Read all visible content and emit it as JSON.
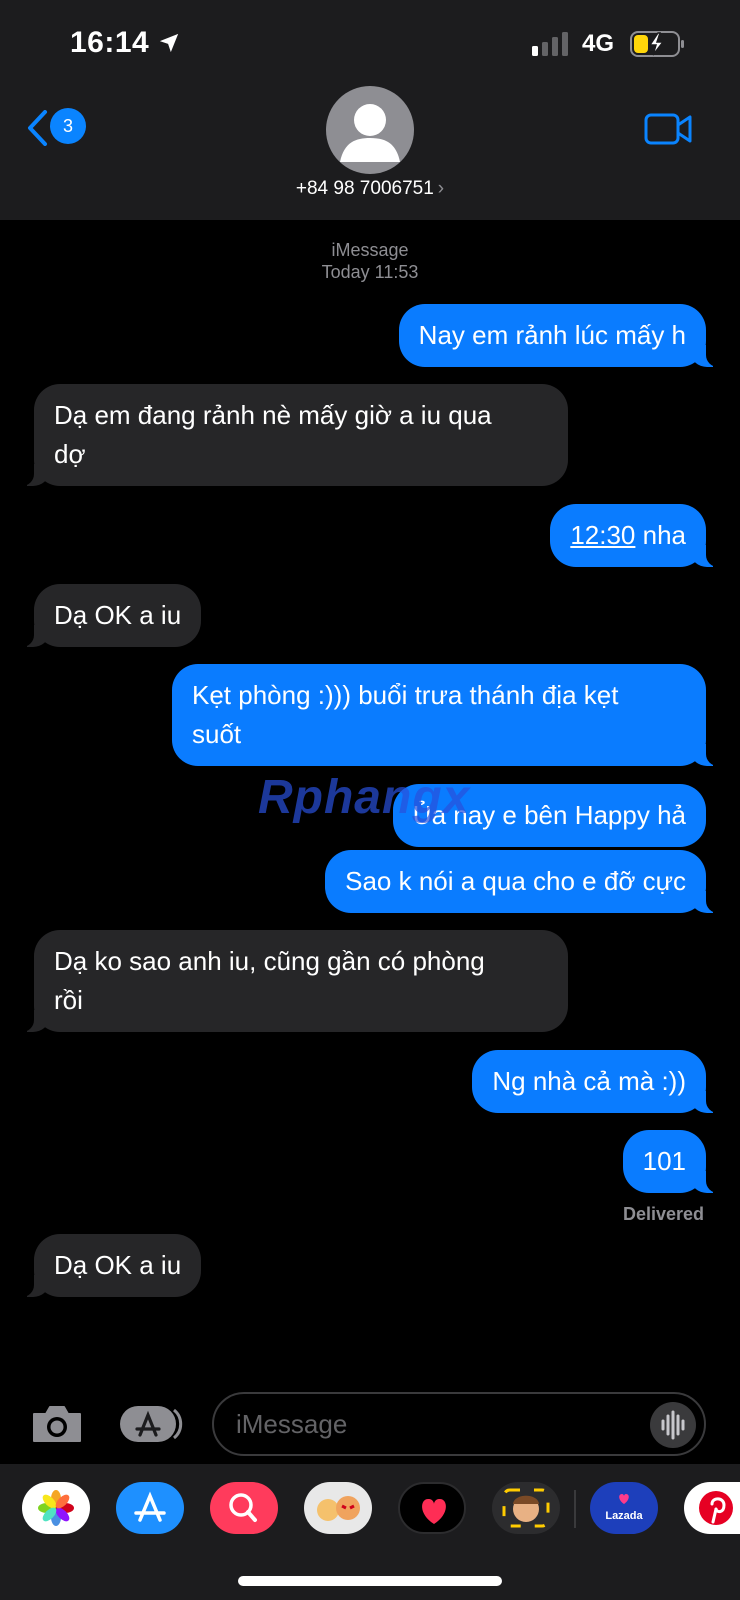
{
  "status": {
    "time": "16:14",
    "network": "4G"
  },
  "header": {
    "back_badge": "3",
    "contact": "+84 98 7006751",
    "chevron": "›"
  },
  "meta": {
    "service": "iMessage",
    "timestamp": "Today 11:53"
  },
  "messages": [
    {
      "dir": "out",
      "text": "Nay em rảnh lúc mấy h"
    },
    {
      "dir": "in",
      "line1": "Dạ em đang rảnh nè mấy giờ a iu qua",
      "line2": "dợ"
    },
    {
      "dir": "out",
      "link": "12:30",
      "rest": " nha"
    },
    {
      "dir": "in",
      "text": "Dạ OK a iu"
    },
    {
      "dir": "out",
      "line1": "Kẹt phòng :))) buổi trưa thánh địa kẹt",
      "line2": "suốt"
    },
    {
      "dir": "out",
      "text": "Ủa nay e bên Happy hả"
    },
    {
      "dir": "out",
      "text": "Sao k nói a qua cho e đỡ cực"
    },
    {
      "dir": "in",
      "line1": "Dạ ko sao anh iu, cũng gần có phòng",
      "line2": "rồi"
    },
    {
      "dir": "out",
      "text": "Ng nhà cả mà :))"
    },
    {
      "dir": "out",
      "text": "101"
    },
    {
      "dir": "in",
      "text": "Dạ OK a iu"
    }
  ],
  "delivered": "Delivered",
  "watermark": {
    "part1": "Rphang",
    "part2": "x"
  },
  "input": {
    "placeholder": "iMessage"
  },
  "tray": {
    "apps": [
      "photos-icon",
      "app-store-icon",
      "search-images-icon",
      "memoji-stickers-icon",
      "digital-touch-icon",
      "memoji-icon",
      "lazada-icon",
      "pinterest-icon"
    ],
    "lazada_label": "Lazada"
  },
  "colors": {
    "outgoing": "#0a7cff",
    "incoming": "#262628",
    "background": "#000000"
  }
}
